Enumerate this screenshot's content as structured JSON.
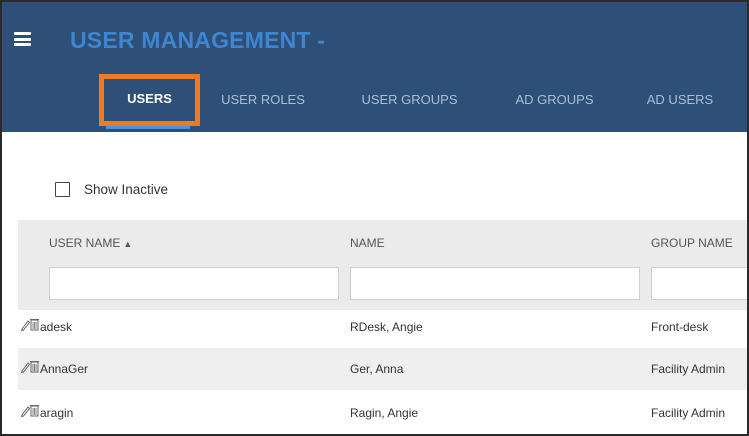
{
  "header": {
    "title": "USER MANAGEMENT -",
    "menu_icon": "hamburger-menu-icon"
  },
  "tabs": [
    {
      "label": "USERS",
      "active": true
    },
    {
      "label": "USER ROLES",
      "active": false
    },
    {
      "label": "USER GROUPS",
      "active": false
    },
    {
      "label": "AD GROUPS",
      "active": false
    },
    {
      "label": "AD USERS",
      "active": false
    }
  ],
  "filters": {
    "show_inactive_label": "Show Inactive",
    "show_inactive_checked": false
  },
  "table": {
    "columns": [
      {
        "label": "USER NAME",
        "sort_icon": "⬍"
      },
      {
        "label": "NAME"
      },
      {
        "label": "GROUP NAME"
      }
    ],
    "rows": [
      {
        "user_name": "adesk",
        "name": "RDesk, Angie",
        "group_name": "Front-desk"
      },
      {
        "user_name": "AnnaGer",
        "name": "Ger, Anna",
        "group_name": "Facility Admin"
      },
      {
        "user_name": "aragin",
        "name": "Ragin, Angie",
        "group_name": "Facility Admin"
      }
    ]
  },
  "colors": {
    "header_bg": "#2e4f78",
    "title": "#3e86cf",
    "active_tab_highlight": "#f07a22",
    "tab_underline": "#4f91dc"
  }
}
